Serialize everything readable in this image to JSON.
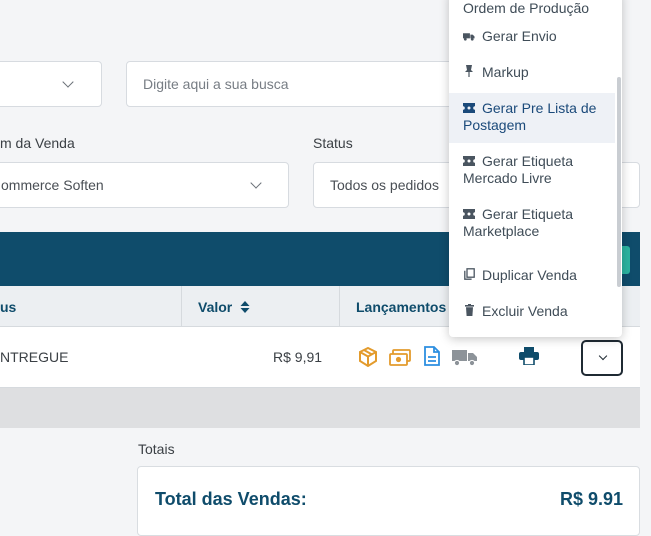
{
  "filters": {
    "search_placeholder": "Digite aqui a sua busca",
    "origem_label": "m da Venda",
    "origem_value": "ommerce Soften",
    "status_label": "Status",
    "status_value": "Todos os pedidos"
  },
  "table": {
    "headers": {
      "status": "us",
      "valor": "Valor",
      "lancamentos": "Lançamentos"
    },
    "row": {
      "status": "NTREGUE",
      "valor": "R$ 9,91"
    }
  },
  "totals": {
    "section_label": "Totais",
    "total_label": "Total das Vendas:",
    "total_value": "R$ 9.91"
  },
  "menu": {
    "items": [
      {
        "label": "Ordem de Produção",
        "icon": "factory-icon"
      },
      {
        "label": "Gerar Envio",
        "icon": "truck-icon"
      },
      {
        "label": "Markup",
        "icon": "pin-icon"
      },
      {
        "label": "Gerar Pre Lista de Postagem",
        "icon": "ticket-icon"
      },
      {
        "label": "Gerar Etiqueta Mercado Livre",
        "icon": "ticket-icon"
      },
      {
        "label": "Gerar Etiqueta Marketplace",
        "icon": "ticket-icon"
      },
      {
        "label": "Duplicar Venda",
        "icon": "copy-icon"
      },
      {
        "label": "Excluir Venda",
        "icon": "trash-icon"
      }
    ]
  },
  "colors": {
    "primary": "#0f4c6b",
    "box_icon": "#e39b2c",
    "document_icon": "#2d8fe0",
    "truck_icon_disabled": "#8d9399"
  }
}
